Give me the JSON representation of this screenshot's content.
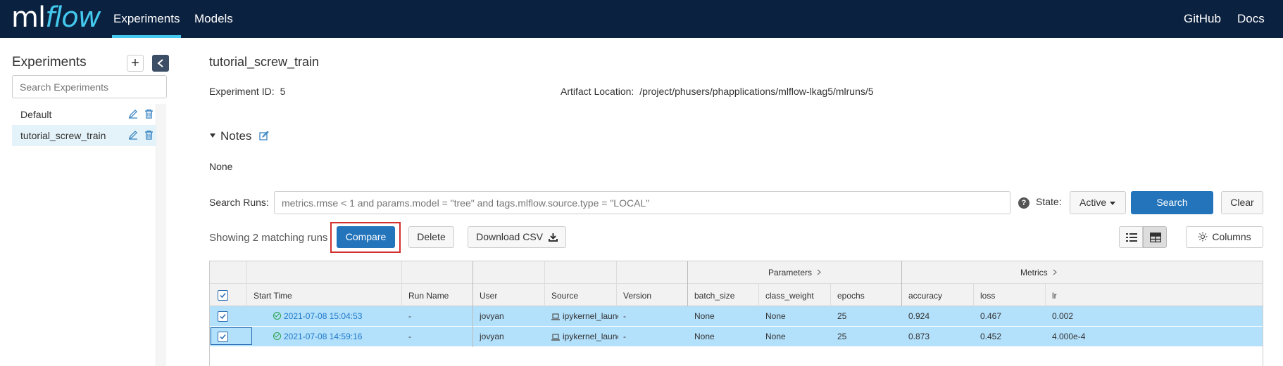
{
  "header": {
    "logo_ml": "ml",
    "logo_flow": "flow",
    "nav": [
      {
        "label": "Experiments",
        "active": true
      },
      {
        "label": "Models",
        "active": false
      }
    ],
    "right_links": [
      {
        "label": "GitHub"
      },
      {
        "label": "Docs"
      }
    ]
  },
  "sidebar": {
    "title": "Experiments",
    "add_label": "+",
    "search_placeholder": "Search Experiments",
    "items": [
      {
        "label": "Default",
        "active": false
      },
      {
        "label": "tutorial_screw_train",
        "active": true
      }
    ]
  },
  "experiment": {
    "title": "tutorial_screw_train",
    "id_label": "Experiment ID:",
    "id_value": "5",
    "artifact_label": "Artifact Location:",
    "artifact_value": "/project/phusers/phapplications/mlflow-lkag5/mlruns/5",
    "notes_label": "Notes",
    "notes_value": "None"
  },
  "search": {
    "label": "Search Runs:",
    "placeholder": "metrics.rmse < 1 and params.model = \"tree\" and tags.mlflow.source.type = \"LOCAL\"",
    "help": "?",
    "state_label": "State:",
    "state_value": "Active",
    "search_button": "Search",
    "clear_button": "Clear"
  },
  "toolbar": {
    "showing": "Showing 2 matching runs",
    "compare": "Compare",
    "delete": "Delete",
    "download_csv": "Download CSV",
    "columns": "Columns"
  },
  "table": {
    "groups": {
      "parameters": "Parameters",
      "metrics": "Metrics"
    },
    "columns": [
      "Start Time",
      "Run Name",
      "User",
      "Source",
      "Version",
      "batch_size",
      "class_weight",
      "epochs",
      "accuracy",
      "loss",
      "lr"
    ],
    "rows": [
      {
        "start_time": "2021-07-08 15:04:53",
        "run_name": "-",
        "user": "jovyan",
        "source": "ipykernel_launc",
        "version": "-",
        "batch_size": "None",
        "class_weight": "None",
        "epochs": "25",
        "accuracy": "0.924",
        "loss": "0.467",
        "lr": "0.002",
        "checked": true
      },
      {
        "start_time": "2021-07-08 14:59:16",
        "run_name": "-",
        "user": "jovyan",
        "source": "ipykernel_launc",
        "version": "-",
        "batch_size": "None",
        "class_weight": "None",
        "epochs": "25",
        "accuracy": "0.873",
        "loss": "0.452",
        "lr": "4.000e-4",
        "checked": true
      }
    ]
  },
  "colors": {
    "header_bg": "#0b2140",
    "accent": "#43c9ed",
    "primary_button": "#2374bb",
    "selected_row": "#b3e0fb",
    "highlight_outline": "#d32f2f"
  }
}
